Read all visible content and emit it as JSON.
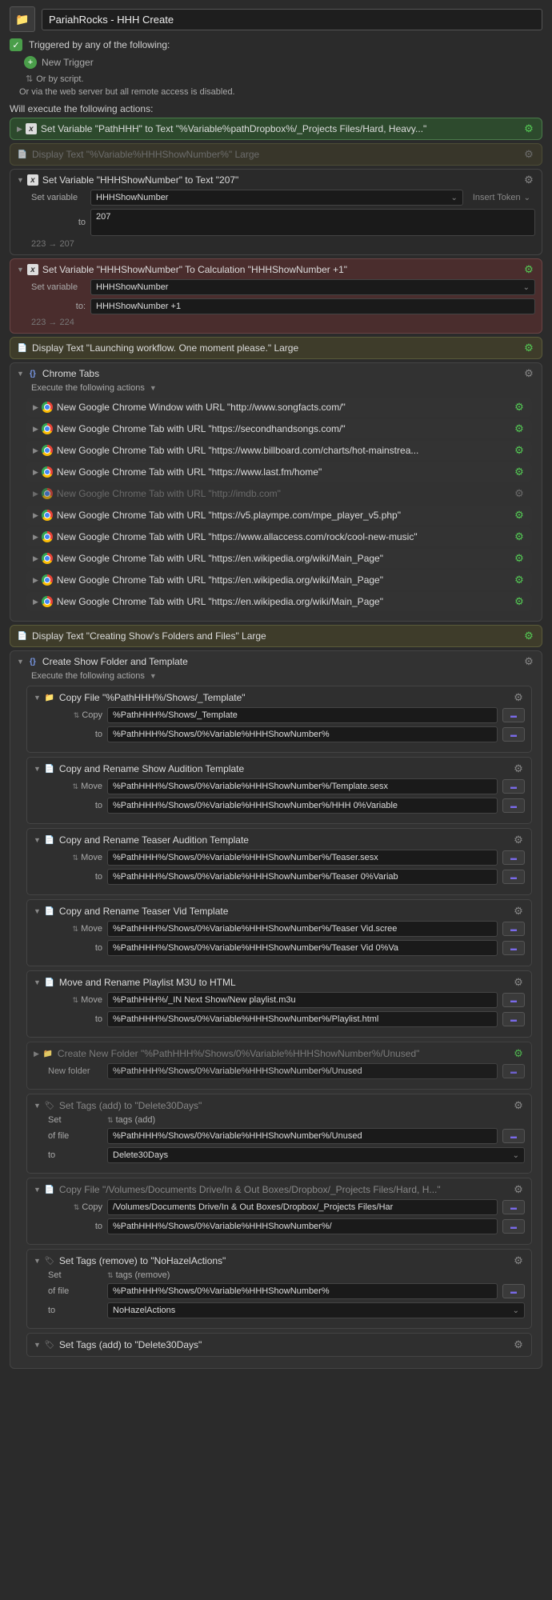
{
  "header": {
    "title": "PariahRocks - HHH Create"
  },
  "trigger": {
    "label": "Triggered by any of the following:",
    "new_trigger": "New Trigger",
    "or_script": "Or by script.",
    "or_web": "Or via the web server but all remote access is disabled."
  },
  "exec_label": "Will execute the following actions:",
  "a_setpath": "Set Variable \"PathHHH\" to Text \"%Variable%pathDropbox%/_Projects Files/Hard, Heavy...\"",
  "a_disp_shownum": "Display Text \"%Variable%HHHShowNumber%\" Large",
  "a_setshow": {
    "title": "Set Variable \"HHHShowNumber\" to Text \"207\"",
    "set_var_label": "Set variable",
    "var_name": "HHHShowNumber",
    "insert_token": "Insert Token",
    "to_label": "to",
    "to_val": "207",
    "result": "223 → 207"
  },
  "a_calc": {
    "title": "Set Variable \"HHHShowNumber\" To Calculation \"HHHShowNumber +1\"",
    "set_var_label": "Set variable",
    "var_name": "HHHShowNumber",
    "to_label": "to:",
    "to_val": "HHHShowNumber +1",
    "result": "223 → 224"
  },
  "a_disp_launch": "Display Text \"Launching workflow. One moment please.\" Large",
  "chrome": {
    "title": "Chrome Tabs",
    "sub": "Execute the following actions",
    "items": [
      "New Google Chrome Window with URL \"http://www.songfacts.com/\"",
      "New Google Chrome Tab with URL \"https://secondhandsongs.com/\"",
      "New Google Chrome Tab with URL \"https://www.billboard.com/charts/hot-mainstrea...",
      "New Google Chrome Tab with URL \"https://www.last.fm/home\"",
      "New Google Chrome Tab with URL \"http://imdb.com\"",
      "New Google Chrome Tab with URL \"https://v5.plaympe.com/mpe_player_v5.php\"",
      "New Google Chrome Tab with URL \"https://www.allaccess.com/rock/cool-new-music\"",
      "New Google Chrome Tab with URL \"https://en.wikipedia.org/wiki/Main_Page\"",
      "New Google Chrome Tab with URL \"https://en.wikipedia.org/wiki/Main_Page\"",
      "New Google Chrome Tab with URL \"https://en.wikipedia.org/wiki/Main_Page\""
    ]
  },
  "a_disp_create": "Display Text \"Creating Show's Folders and Files\" Large",
  "folder": {
    "title": "Create Show Folder and Template",
    "sub": "Execute the following actions",
    "copy1": {
      "title": "Copy File \"%PathHHH%/Shows/_Template\"",
      "op": "Copy",
      "from": "%PathHHH%/Shows/_Template",
      "to_label": "to",
      "to": "%PathHHH%/Shows/0%Variable%HHHShowNumber%"
    },
    "copy2": {
      "title": "Copy and Rename Show Audition Template",
      "op": "Move",
      "from": "%PathHHH%/Shows/0%Variable%HHHShowNumber%/Template.sesx",
      "to_label": "to",
      "to": "%PathHHH%/Shows/0%Variable%HHHShowNumber%/HHH 0%Variable"
    },
    "copy3": {
      "title": "Copy and Rename Teaser Audition Template",
      "op": "Move",
      "from": "%PathHHH%/Shows/0%Variable%HHHShowNumber%/Teaser.sesx",
      "to_label": "to",
      "to": "%PathHHH%/Shows/0%Variable%HHHShowNumber%/Teaser 0%Variab"
    },
    "copy4": {
      "title": "Copy and Rename Teaser Vid Template",
      "op": "Move",
      "from": "%PathHHH%/Shows/0%Variable%HHHShowNumber%/Teaser Vid.scree",
      "to_label": "to",
      "to": "%PathHHH%/Shows/0%Variable%HHHShowNumber%/Teaser Vid 0%Va"
    },
    "copy5": {
      "title": "Move and Rename Playlist M3U to HTML",
      "op": "Move",
      "from": "%PathHHH%/_IN Next Show/New playlist.m3u",
      "to_label": "to",
      "to": "%PathHHH%/Shows/0%Variable%HHHShowNumber%/Playlist.html"
    },
    "newfolder": {
      "title": "Create New Folder \"%PathHHH%/Shows/0%Variable%HHHShowNumber%/Unused\"",
      "label": "New folder",
      "val": "%PathHHH%/Shows/0%Variable%HHHShowNumber%/Unused"
    },
    "tags1": {
      "title": "Set Tags (add) to \"Delete30Days\"",
      "set": "Set",
      "mode": "tags (add)",
      "of_label": "of file",
      "of": "%PathHHH%/Shows/0%Variable%HHHShowNumber%/Unused",
      "to_label": "to",
      "to": "Delete30Days"
    },
    "copy6": {
      "title": "Copy File \"/Volumes/Documents Drive/In & Out Boxes/Dropbox/_Projects Files/Hard, H...\"",
      "op": "Copy",
      "from": "/Volumes/Documents Drive/In & Out Boxes/Dropbox/_Projects Files/Har",
      "to_label": "to",
      "to": "%PathHHH%/Shows/0%Variable%HHHShowNumber%/"
    },
    "tags2": {
      "title": "Set Tags (remove) to \"NoHazelActions\"",
      "set": "Set",
      "mode": "tags (remove)",
      "of_label": "of file",
      "of": "%PathHHH%/Shows/0%Variable%HHHShowNumber%",
      "to_label": "to",
      "to": "NoHazelActions"
    },
    "tags3": {
      "title": "Set Tags (add) to \"Delete30Days\""
    }
  }
}
